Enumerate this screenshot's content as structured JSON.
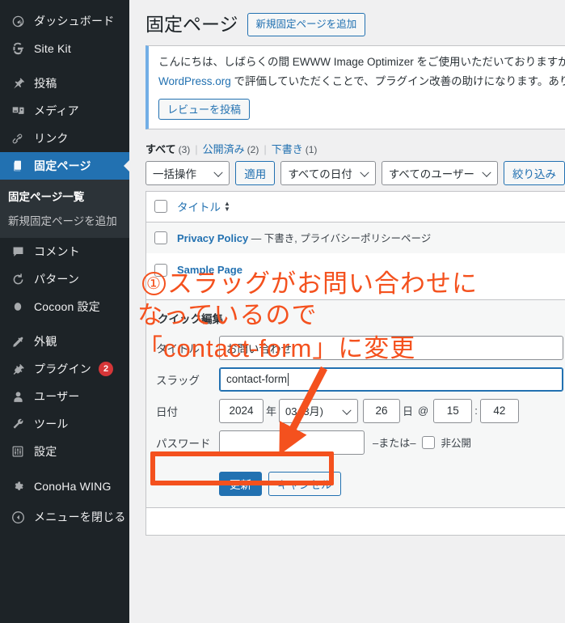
{
  "sidebar": {
    "items": [
      {
        "label": "ダッシュボード",
        "icon": "dashboard-icon",
        "id": "dashboard"
      },
      {
        "label": "Site Kit",
        "icon": "google-g-icon",
        "id": "site-kit"
      },
      {
        "label": "投稿",
        "icon": "pin-icon",
        "id": "posts"
      },
      {
        "label": "メディア",
        "icon": "media-icon",
        "id": "media"
      },
      {
        "label": "リンク",
        "icon": "link-icon",
        "id": "links"
      },
      {
        "label": "固定ページ",
        "icon": "page-icon",
        "id": "pages",
        "current": true
      },
      {
        "label": "コメント",
        "icon": "comment-icon",
        "id": "comments"
      },
      {
        "label": "パターン",
        "icon": "pattern-icon",
        "id": "patterns"
      },
      {
        "label": "Cocoon 設定",
        "icon": "cocoon-icon",
        "id": "cocoon-settings"
      },
      {
        "label": "外観",
        "icon": "appearance-icon",
        "id": "appearance"
      },
      {
        "label": "プラグイン",
        "icon": "plugin-icon",
        "id": "plugins",
        "badge": "2"
      },
      {
        "label": "ユーザー",
        "icon": "user-icon",
        "id": "users"
      },
      {
        "label": "ツール",
        "icon": "tools-icon",
        "id": "tools"
      },
      {
        "label": "設定",
        "icon": "settings-icon",
        "id": "settings"
      },
      {
        "label": "ConoHa WING",
        "icon": "gear-icon",
        "id": "conoha-wing"
      },
      {
        "label": "メニューを閉じる",
        "icon": "collapse-icon",
        "id": "collapse-menu"
      }
    ],
    "submenu": [
      {
        "label": "固定ページ一覧",
        "current": true
      },
      {
        "label": "新規固定ページを追加",
        "current": false
      }
    ]
  },
  "header": {
    "title": "固定ページ",
    "add_new_label": "新規固定ページを追加"
  },
  "notice": {
    "line1": "こんにちは、しばらくの間 EWWW Image Optimizer をご使用いただいておりますが、",
    "line2_pre": "WordPress.org",
    "line2_post": " で評価していただくことで、プラグイン改善の助けになります。ありが",
    "button_label": "レビューを投稿"
  },
  "status_links": [
    {
      "label": "すべて",
      "count": "(3)",
      "current": true
    },
    {
      "label": "公開済み",
      "count": "(2)",
      "current": false
    },
    {
      "label": "下書き",
      "count": "(1)",
      "current": false
    }
  ],
  "tablenav": {
    "bulk_action": "一括操作",
    "apply_label": "適用",
    "date_filter": "すべての日付",
    "user_filter": "すべてのユーザー",
    "filter_label": "絞り込み"
  },
  "table": {
    "column_title": "タイトル",
    "rows": [
      {
        "title": "Privacy Policy",
        "state": "— 下書き, プライバシーポリシーページ"
      },
      {
        "title": "Sample Page",
        "state": ""
      }
    ]
  },
  "quick_edit": {
    "legend": "クイック編集",
    "title_label": "タイトル",
    "title_value": "お問い合わせ",
    "slug_label": "スラッグ",
    "slug_value": "contact-form",
    "date_label": "日付",
    "date_year": "2024",
    "unit_year": "年",
    "date_month": "03 (3月)",
    "date_day": "26",
    "unit_day": "日",
    "at_symbol": "@",
    "date_hour": "15",
    "time_sep": ":",
    "date_minute": "42",
    "password_label": "パスワード",
    "password_value": "",
    "or_text": "–または–",
    "private_label": "非公開",
    "update_label": "更新",
    "cancel_label": "キャンセル"
  },
  "annotation": {
    "marker": "①",
    "line1": "スラッグがお問い合わせに",
    "line2": "なっているので",
    "line3": "「contact-form」に変更",
    "color": "#f4511e"
  },
  "colors": {
    "sidebar_bg": "#1d2327",
    "submenu_bg": "#2c3338",
    "accent": "#2271b1",
    "badge": "#d63638",
    "page_bg": "#f0f0f1",
    "annotation": "#f4511e"
  }
}
